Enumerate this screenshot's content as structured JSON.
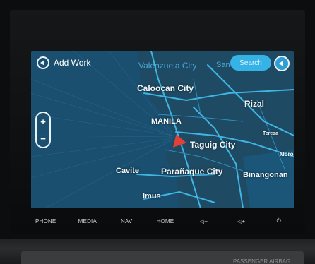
{
  "header": {
    "add_work_label": "Add Work",
    "search_label": "Search"
  },
  "zoom": {
    "plus": "+",
    "minus": "−"
  },
  "map": {
    "labels": {
      "valenzuela": "Valenzuela City",
      "san": "San",
      "caloocan": "Caloocan City",
      "rizal": "Rizal",
      "manila": "MANILA",
      "teresa": "Teresa",
      "taguig": "Taguig City",
      "moro": "Moro",
      "cavite": "Cavite",
      "paranaque": "Parañaque City",
      "binangonan": "Binangonan",
      "imus": "Imus"
    },
    "colors": {
      "water": "#1b5577",
      "land": "#1f4c66",
      "roads": "#3fb5e3"
    }
  },
  "hardware_buttons": {
    "phone": "PHONE",
    "media": "MEDIA",
    "nav": "NAV",
    "home": "HOME",
    "vol_down": "◁−",
    "vol_up": "◁+",
    "power": "⏻"
  },
  "dashboard": {
    "airbag_label": "PASSENGER AIRBAG"
  }
}
